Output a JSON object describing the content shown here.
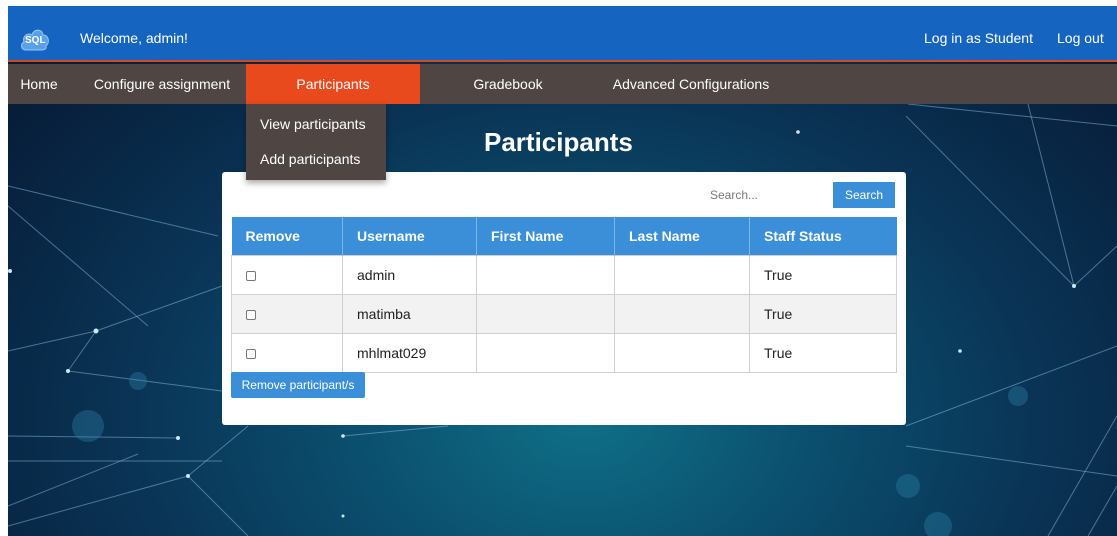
{
  "header": {
    "logo_text": "SQL",
    "welcome_text": "Welcome, admin!",
    "login_as_student": "Log in as Student",
    "logout": "Log out",
    "bg_color": "#1565c0",
    "accent_color": "#e8491d"
  },
  "nav": {
    "items": [
      {
        "label": "Home"
      },
      {
        "label": "Configure assignment"
      },
      {
        "label": "Participants",
        "active": true
      },
      {
        "label": "Gradebook"
      },
      {
        "label": "Advanced Configurations"
      }
    ],
    "dropdown": [
      {
        "label": "View participants"
      },
      {
        "label": "Add participants"
      }
    ]
  },
  "main": {
    "title": "Participants",
    "search": {
      "placeholder": "Search...",
      "value": "",
      "button_label": "Search"
    },
    "table": {
      "columns": [
        "Remove",
        "Username",
        "First Name",
        "Last Name",
        "Staff Status"
      ],
      "rows": [
        {
          "checked": false,
          "username": "admin",
          "first_name": "",
          "last_name": "",
          "staff_status": "True"
        },
        {
          "checked": false,
          "username": "matimba",
          "first_name": "",
          "last_name": "",
          "staff_status": "True"
        },
        {
          "checked": false,
          "username": "mhlmat029",
          "first_name": "",
          "last_name": "",
          "staff_status": "True"
        }
      ]
    },
    "remove_button_label": "Remove participant/s"
  }
}
